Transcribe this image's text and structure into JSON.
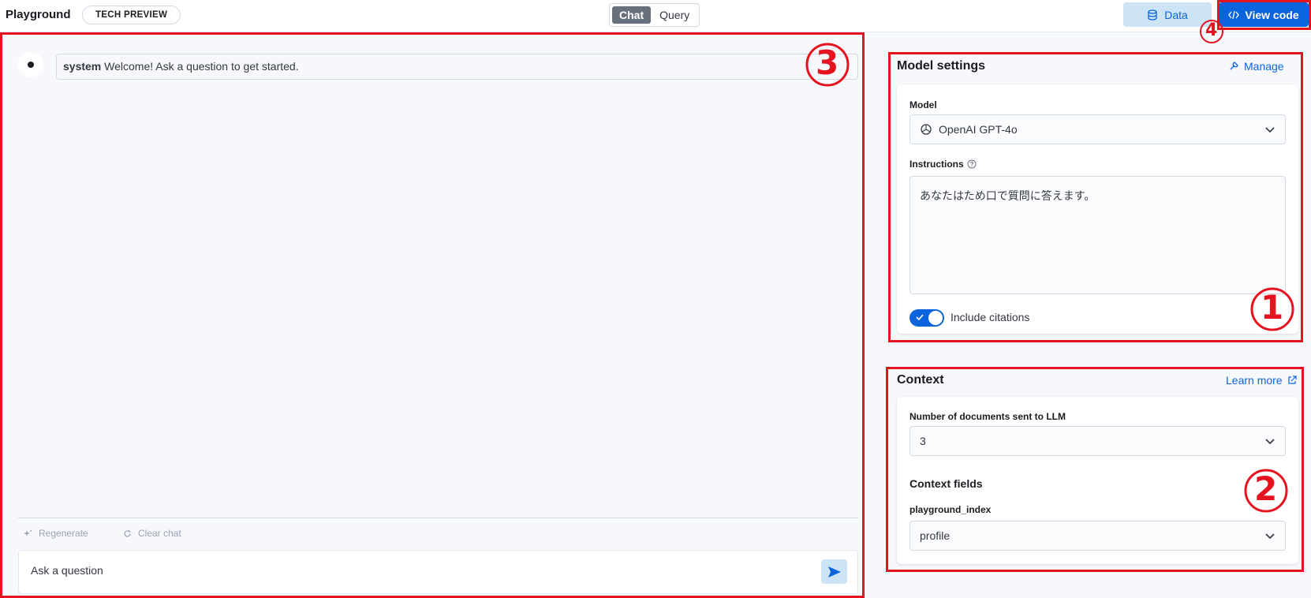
{
  "header": {
    "title": "Playground",
    "badge": "TECH PREVIEW",
    "modes": [
      "Chat",
      "Query"
    ],
    "active_mode": "Chat",
    "data_button": "Data",
    "view_code_button": "View code"
  },
  "chat": {
    "messages": [
      {
        "role": "system",
        "text": "Welcome! Ask a question to get started."
      }
    ],
    "regenerate_label": "Regenerate",
    "clear_chat_label": "Clear chat",
    "input_placeholder": "Ask a question"
  },
  "model_settings": {
    "title": "Model settings",
    "manage_link": "Manage",
    "model_label": "Model",
    "model_value": "OpenAI GPT-4o",
    "instructions_label": "Instructions",
    "instructions_value": "あなたはため口で質問に答えます。",
    "include_citations_label": "Include citations",
    "include_citations": true
  },
  "context": {
    "title": "Context",
    "learn_more_link": "Learn more",
    "num_docs_label": "Number of documents sent to LLM",
    "num_docs_value": "3",
    "fields_title": "Context fields",
    "index_label": "playground_index",
    "index_field_value": "profile"
  },
  "annotations": {
    "one": "1",
    "two": "2",
    "three": "3",
    "four": "4"
  },
  "colors": {
    "accent": "#0b64dd",
    "annotation": "#e5121f"
  }
}
